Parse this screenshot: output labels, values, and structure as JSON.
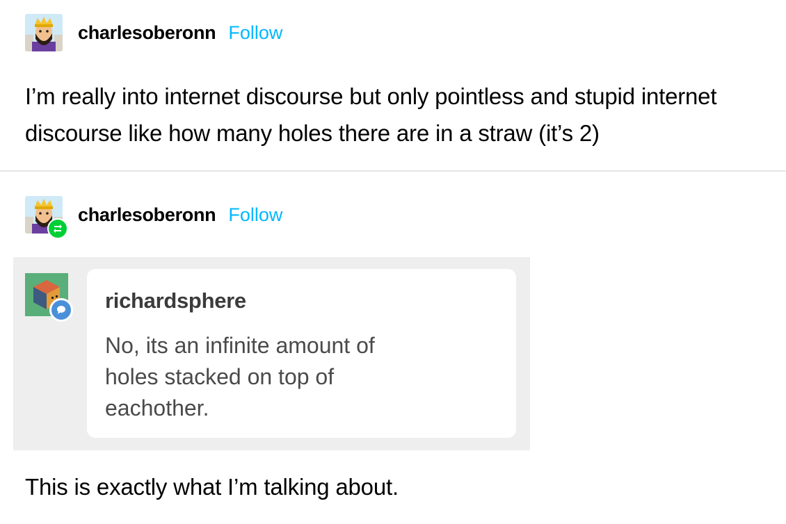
{
  "original_post": {
    "username": "charlesoberonn",
    "follow_label": "Follow",
    "text": "I’m really into internet discourse but only pointless and stupid internet discourse like how many holes there are in a straw (it’s 2)"
  },
  "reblog": {
    "username": "charlesoberonn",
    "follow_label": "Follow",
    "embedded_screenshot": {
      "username": "richardsphere",
      "message": "No, its an infinite amount of holes stacked on top of eachother."
    },
    "text": "This is exactly what I’m talking about."
  },
  "colors": {
    "follow": "#00b8ff",
    "reblog_badge": "#00cf35",
    "chat_badge": "#4a90d9",
    "screenshot_bg": "#eeeeee"
  },
  "icons": {
    "avatar": "bearded-king-avatar-icon",
    "reblog": "reblog-icon",
    "cube_avatar": "cube-avatar-icon",
    "chat": "chat-bubble-icon"
  }
}
